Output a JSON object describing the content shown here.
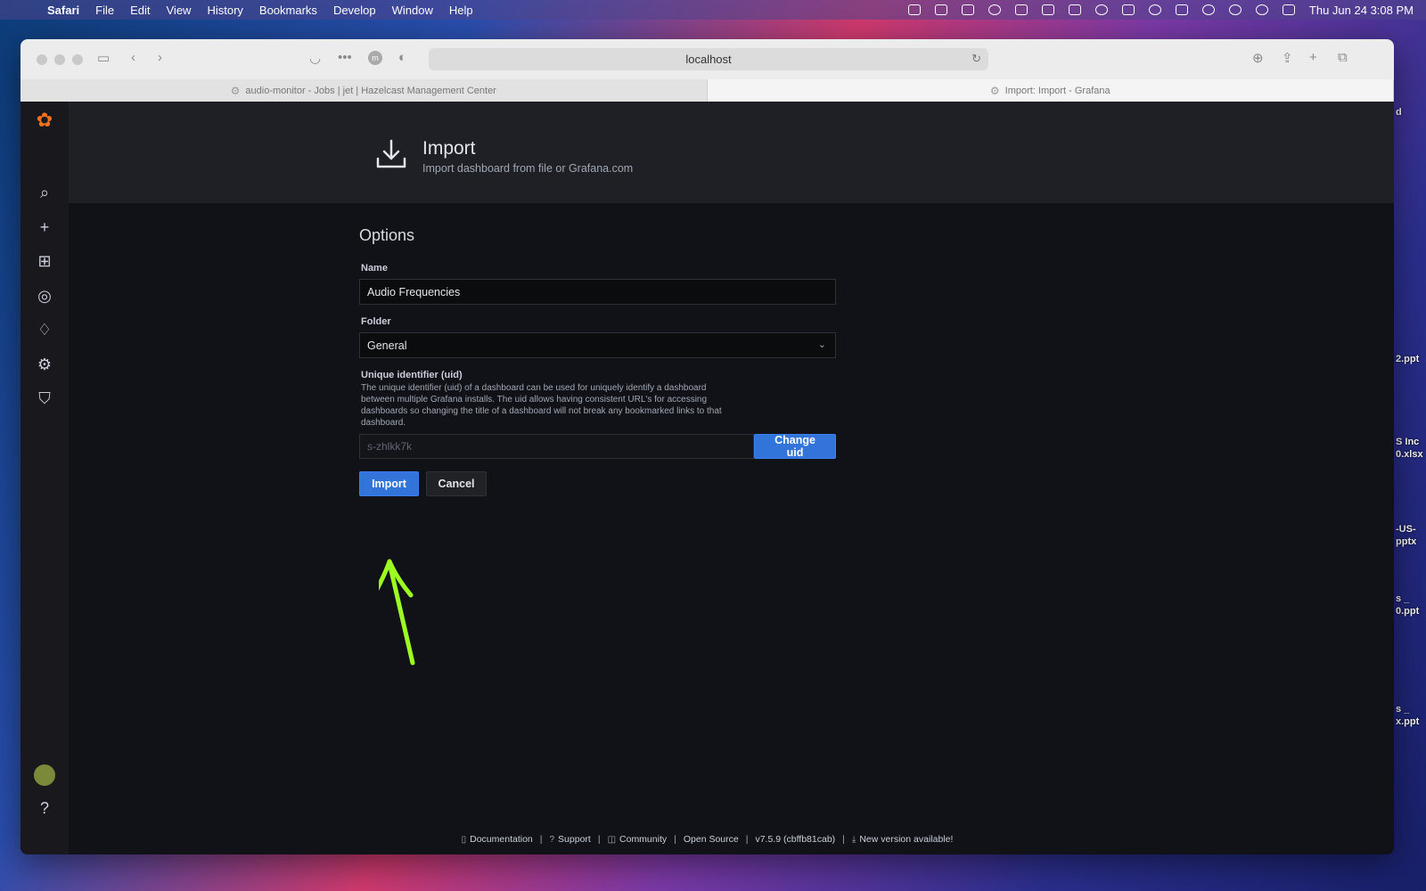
{
  "menubar": {
    "app": "Safari",
    "items": [
      "File",
      "Edit",
      "View",
      "History",
      "Bookmarks",
      "Develop",
      "Window",
      "Help"
    ],
    "clock": "Thu Jun 24  3:08 PM"
  },
  "desktop_labels": [
    "d",
    "2.ppt",
    "S Inc",
    "0.xlsx",
    "-US-",
    "pptx",
    "s _",
    "0.ppt",
    "s _",
    "x.ppt"
  ],
  "browser": {
    "address": "localhost",
    "extension_badge": "1",
    "tabs": [
      {
        "label": "audio-monitor - Jobs | jet | Hazelcast Management Center"
      },
      {
        "label": "Import: Import - Grafana"
      }
    ]
  },
  "header": {
    "title": "Import",
    "subtitle": "Import dashboard from file or Grafana.com"
  },
  "options": {
    "title": "Options",
    "name_label": "Name",
    "name_value": "Audio Frequencies",
    "folder_label": "Folder",
    "folder_value": "General",
    "uid_label": "Unique identifier (uid)",
    "uid_description": "The unique identifier (uid) of a dashboard can be used for uniquely identify a dashboard between multiple Grafana installs. The uid allows having consistent URL's for accessing dashboards so changing the title of a dashboard will not break any bookmarked links to that dashboard.",
    "uid_value": "s-zhlkk7k",
    "change_uid_label": "Change uid",
    "import_label": "Import",
    "cancel_label": "Cancel"
  },
  "footer": {
    "documentation": "Documentation",
    "support": "Support",
    "community": "Community",
    "open_source": "Open Source",
    "version": "v7.5.9 (cbffb81cab)",
    "new_version": "New version available!"
  },
  "colors": {
    "primary": "#3274d9",
    "annotation_arrow": "#9dff1f",
    "grafana_logo": "#f16f1f"
  }
}
